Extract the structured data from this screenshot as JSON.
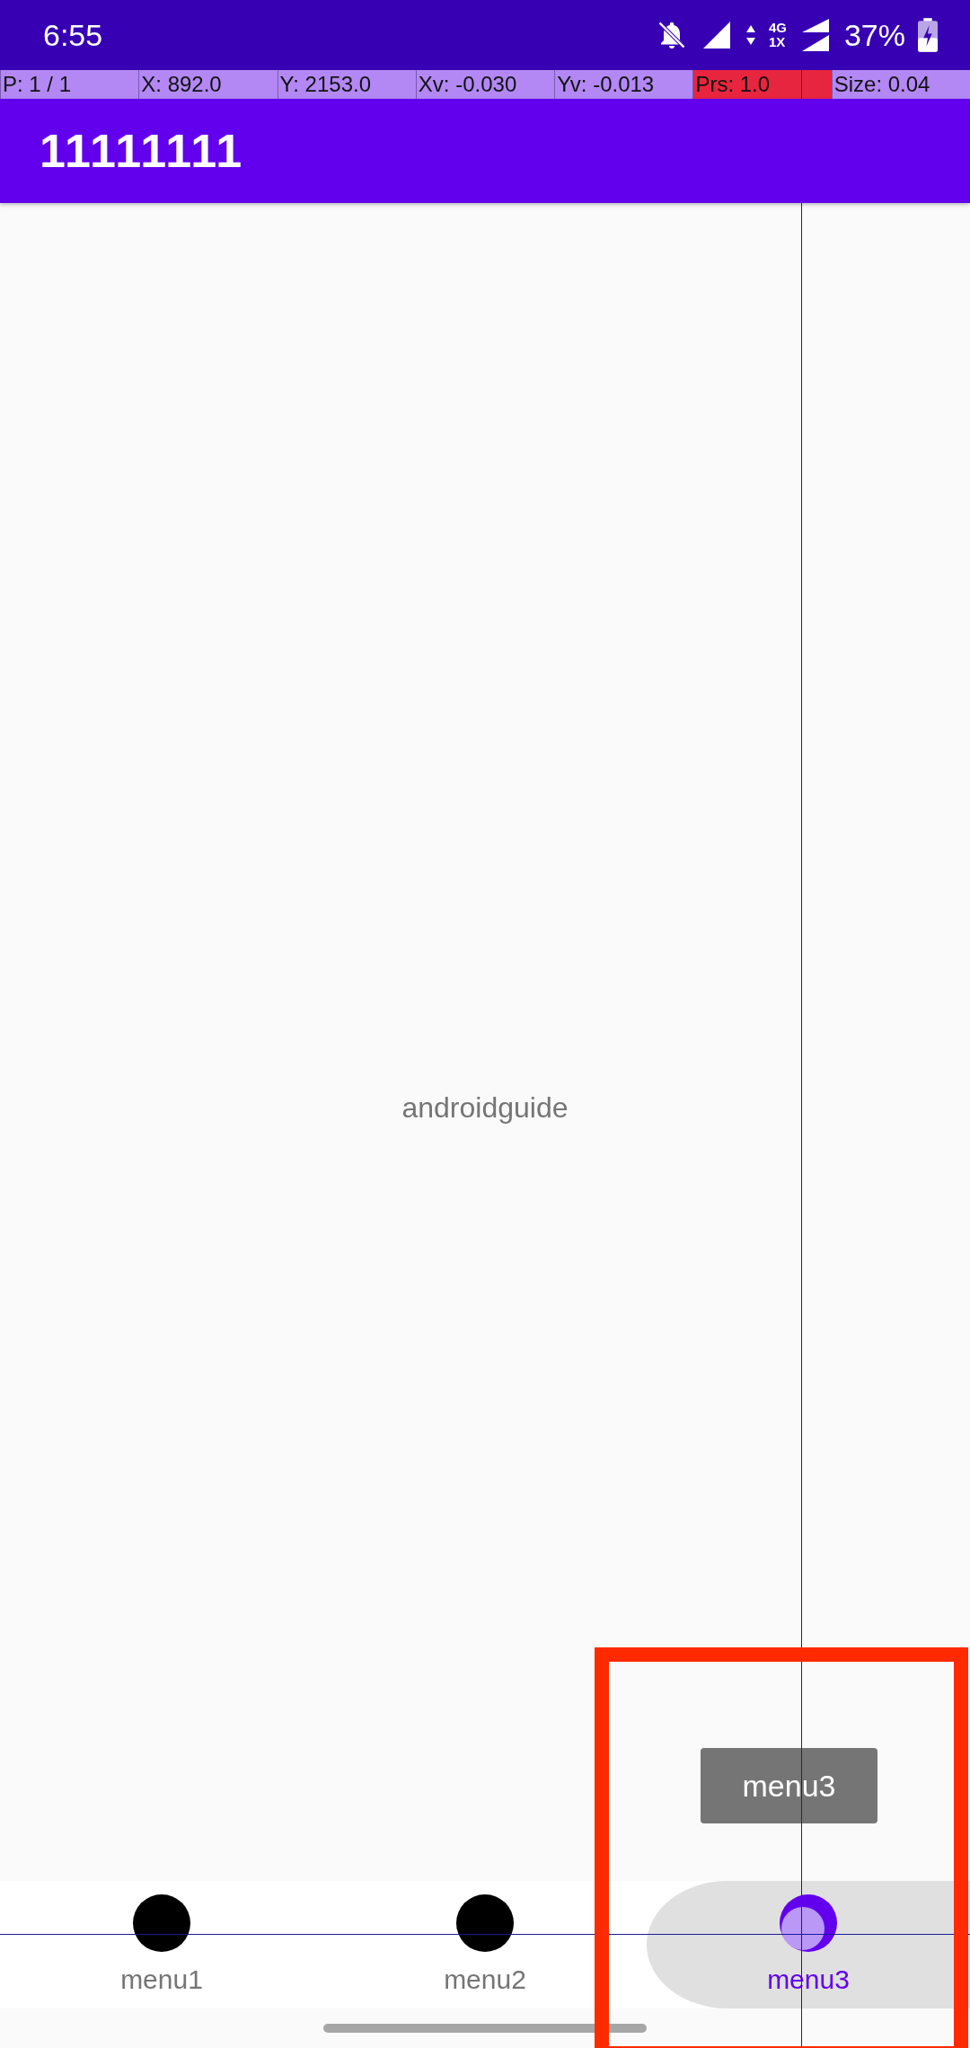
{
  "status_bar": {
    "time": "6:55",
    "network_top": "4G",
    "network_bottom": "1X",
    "battery": "37%"
  },
  "pointer_info": [
    {
      "text": "P: 1 / 1",
      "highlighted": false
    },
    {
      "text": "X: 892.0",
      "highlighted": false
    },
    {
      "text": "Y: 2153.0",
      "highlighted": false
    },
    {
      "text": "Xv: -0.030",
      "highlighted": false
    },
    {
      "text": "Yv: -0.013",
      "highlighted": false
    },
    {
      "text": "Prs: 1.0",
      "highlighted": true
    },
    {
      "text": "Size: 0.04",
      "highlighted": false
    }
  ],
  "app_bar": {
    "title": "11111111"
  },
  "content": {
    "text": "androidguide"
  },
  "toast": {
    "text": "menu3"
  },
  "bottom_nav": [
    {
      "label": "menu1",
      "selected": false
    },
    {
      "label": "menu2",
      "selected": false
    },
    {
      "label": "menu3",
      "selected": true
    }
  ]
}
